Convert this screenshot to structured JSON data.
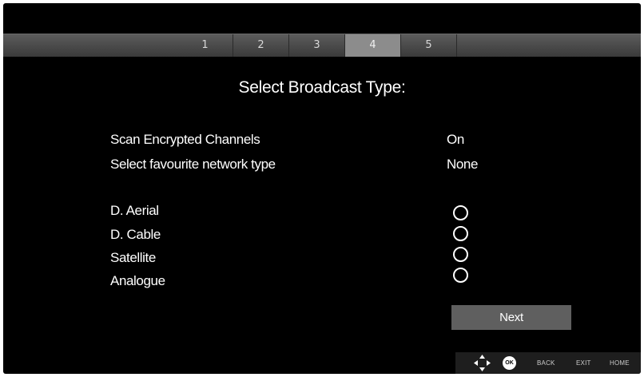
{
  "steps": {
    "items": [
      "1",
      "2",
      "3",
      "4",
      "5"
    ],
    "active_index": 3
  },
  "title": "Select Broadcast Type:",
  "settings": {
    "scan_encrypted": {
      "label": "Scan Encrypted Channels",
      "value": "On"
    },
    "favourite_network": {
      "label": "Select favourite network type",
      "value": "None"
    }
  },
  "broadcast_types": [
    {
      "label": "D. Aerial",
      "selected": false
    },
    {
      "label": "D. Cable",
      "selected": false
    },
    {
      "label": "Satellite",
      "selected": false
    },
    {
      "label": "Analogue",
      "selected": false
    }
  ],
  "next_label": "Next",
  "help": {
    "ok": "OK",
    "back": "BACK",
    "exit": "EXIT",
    "home": "HOME"
  },
  "colors": {
    "background": "#000000",
    "active_step": "#8c8c8c",
    "button": "#5f5f5f"
  }
}
